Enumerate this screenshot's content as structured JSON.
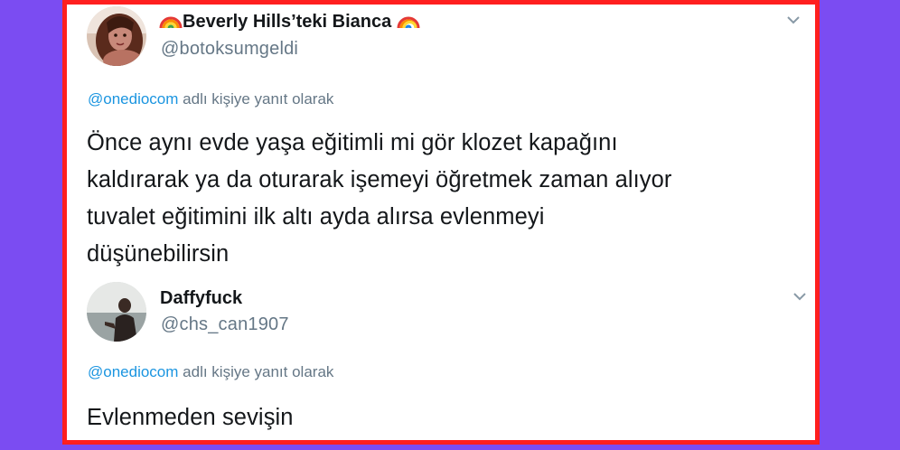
{
  "tweets": [
    {
      "display_name_emoji": "🌈",
      "display_name": "Beverly Hills’teki Bianca",
      "handle": "@botoksumgeldi",
      "reply_mention": "@onediocom",
      "reply_suffix": " adlı kişiye yanıt olarak",
      "text_lines": [
        "Önce aynı evde yaşa eğitimli mi gör klozet kapağını",
        "kaldırarak ya da oturarak işemeyi öğretmek zaman alıyor",
        "tuvalet eğitimini ilk altı ayda alırsa evlenmeyi",
        "düşünebilirsin"
      ],
      "avatar_icon": "avatar-woman-photo"
    },
    {
      "display_name": "Daffyfuck",
      "handle": "@chs_can1907",
      "reply_mention": "@onediocom",
      "reply_suffix": " adlı kişiye yanıt olarak",
      "text_lines": [
        "Evlenmeden sevişin"
      ],
      "avatar_icon": "avatar-man-seaside-photo"
    }
  ],
  "colors": {
    "background": "#7b4cf2",
    "frame": "#ff1f1f",
    "mention": "#1b95e0",
    "secondary_text": "#657786",
    "primary_text": "#14171a"
  }
}
